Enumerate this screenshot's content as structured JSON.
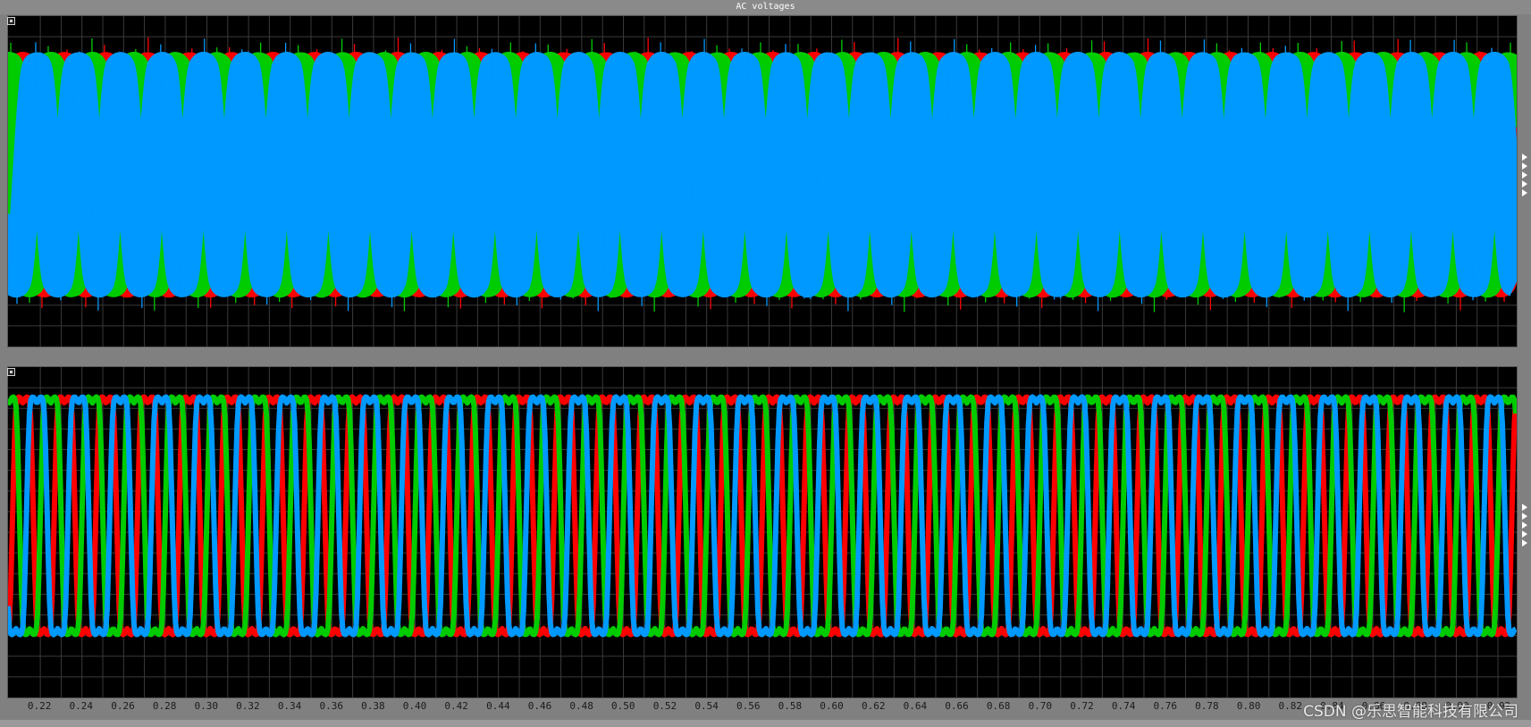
{
  "window": {
    "title": "AC voltages"
  },
  "axis": {
    "tick_labels": [
      "0.22",
      "0.24",
      "0.26",
      "0.28",
      "0.30",
      "0.32",
      "0.34",
      "0.36",
      "0.38",
      "0.40",
      "0.42",
      "0.44",
      "0.46",
      "0.48",
      "0.50",
      "0.52",
      "0.54",
      "0.56",
      "0.58",
      "0.60",
      "0.62",
      "0.64",
      "0.66",
      "0.68",
      "0.70",
      "0.72",
      "0.74",
      "0.76",
      "0.78",
      "0.80",
      "0.82",
      "0.84",
      "0.86",
      "0.88",
      "0.90",
      "0.92"
    ],
    "x_range": [
      0.2045,
      0.929
    ],
    "suffix": "x1"
  },
  "watermark": "CSDN @乐思智能科技有限公司",
  "colors": {
    "phase_a": "#ff0000",
    "phase_b": "#00cc00",
    "phase_c": "#0099ff",
    "grid": "#3a3a3a",
    "background": "#000000"
  },
  "icons": {
    "pin": "pin-icon",
    "marker": "triangle-marker-icon"
  },
  "chart_data": [
    {
      "type": "line",
      "title": "AC voltages",
      "frequency_hz": 50,
      "x_range": [
        0.2045,
        0.929
      ],
      "grid": true,
      "series": [
        {
          "color": "#ff0000",
          "shape": "sine with PWM ripple",
          "phase_deg": -120,
          "band": 0.2
        },
        {
          "color": "#00cc00",
          "shape": "sine with PWM ripple",
          "phase_deg": 0,
          "band": 0.2
        },
        {
          "color": "#0099ff",
          "shape": "sine with PWM ripple",
          "phase_deg": 120,
          "band": 0.2
        }
      ]
    },
    {
      "type": "line",
      "frequency_hz": 50,
      "x_range": [
        0.2045,
        0.929
      ],
      "grid": true,
      "series": [
        {
          "color": "#ff0000",
          "shape": "distorted flat-top wave",
          "phase_deg": -120
        },
        {
          "color": "#00cc00",
          "shape": "distorted flat-top wave",
          "phase_deg": 0
        },
        {
          "color": "#0099ff",
          "shape": "distorted flat-top wave",
          "phase_deg": 120
        }
      ]
    }
  ]
}
